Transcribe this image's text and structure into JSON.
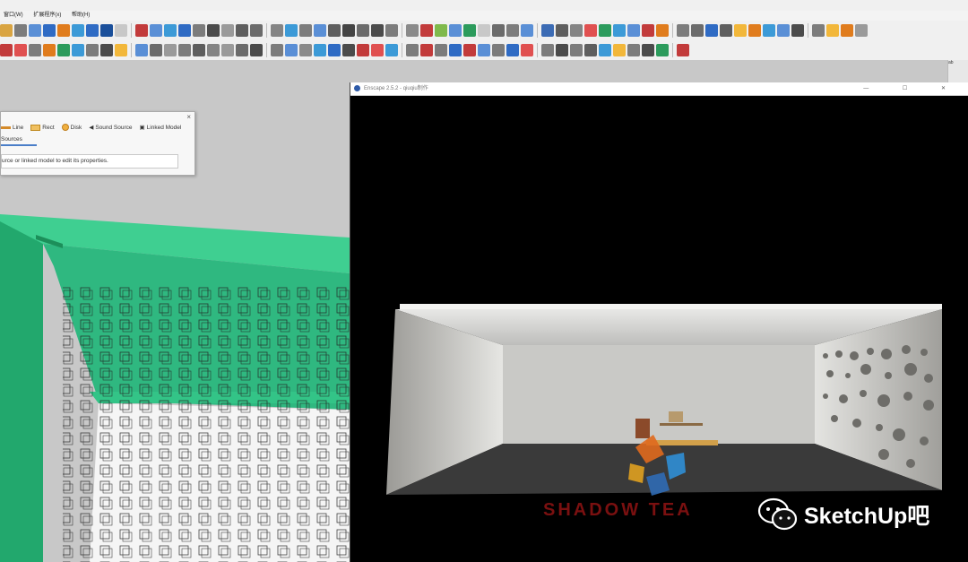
{
  "menubar": {
    "items": [
      "窗口(W)",
      "扩展程序(x)",
      "帮助(H)"
    ]
  },
  "toolbars": {
    "row1": [
      "#d9a441",
      "#7c7c7c",
      "#5a8fd6",
      "#2f6bc4",
      "#e07c1d",
      "#3c9ad7",
      "#2f6bc4",
      "#1a4f9a",
      "#c8c8c8",
      "#c23b3b",
      "#5a8fd6",
      "#3c9ad7",
      "#2f6bc4",
      "#7c7c7c",
      "#4b4b4b",
      "#9a9a9a",
      "#5e5e5e",
      "#6b6b6b",
      "#848484",
      "#3c9ad7",
      "#7c7c7c",
      "#5a8fd6",
      "#5e5e5e",
      "#444444",
      "#6b6b6b",
      "#4b4b4b",
      "#7c7c7c",
      "#8a8a8a",
      "#c23b3b",
      "#7fb94b",
      "#5a8fd6",
      "#2c9b5c",
      "#c8c8c8",
      "#6b6b6b",
      "#7c7c7c",
      "#5a8fd6",
      "#3b6bb4",
      "#5e5e5e",
      "#848484",
      "#e05050",
      "#2c9b5c",
      "#3c9ad7",
      "#5a8fd6",
      "#c23b3b",
      "#e07c1d",
      "#7c7c7c",
      "#6b6b6b",
      "#2f6bc4",
      "#5e5e5e",
      "#f2b73a",
      "#e07c1d",
      "#3c9ad7",
      "#5a8fd6",
      "#4b4b4b",
      "#7c7c7c",
      "#f2b73a",
      "#e07c1d",
      "#9a9a9a"
    ],
    "row2": [
      "#c23b3b",
      "#e05050",
      "#7c7c7c",
      "#e07c1d",
      "#2c9b5c",
      "#3c9ad7",
      "#7c7c7c",
      "#4b4b4b",
      "#f2b73a",
      "#5a8fd6",
      "#6b6b6b",
      "#9a9a9a",
      "#7c7c7c",
      "#5e5e5e",
      "#848484",
      "#9a9a9a",
      "#6b6b6b",
      "#4b4b4b",
      "#7c7c7c",
      "#5a8fd6",
      "#8a8a8a",
      "#3c9ad7",
      "#2f6bc4",
      "#4b4b4b",
      "#c23b3b",
      "#e05050",
      "#3c9ad7",
      "#7c7c7c",
      "#c23b3b",
      "#7c7c7c",
      "#2f6bc4",
      "#c23b3b",
      "#5a8fd6",
      "#7c7c7c",
      "#2f6bc4",
      "#e05050",
      "#7c7c7c",
      "#4b4b4b",
      "#7c7c7c",
      "#5e5e5e",
      "#3c9ad7",
      "#f2b73a",
      "#7c7c7c",
      "#4b4b4b",
      "#2c9b5c",
      "#c23b3b"
    ]
  },
  "right_panel": {
    "tab_label": "ab"
  },
  "lights_dialog": {
    "types": [
      "Line",
      "Rect",
      "Disk",
      "Sound Source",
      "Linked Model"
    ],
    "tab": "Sources",
    "hint": "urce or linked model to edit its properties.",
    "close": "×"
  },
  "enscape_window": {
    "title": "Enscape 2.5.2 - qiuqiu制作",
    "controls": "— ☐ ✕",
    "overlay_text": "SHADOW TEA"
  },
  "watermark": {
    "text": "SketchUp吧"
  },
  "colors": {
    "wall_green": "#2fb880",
    "toolbar_bg": "#f0f0f0",
    "viewport_bg": "#c8c8c8",
    "render_bg": "#000000"
  }
}
